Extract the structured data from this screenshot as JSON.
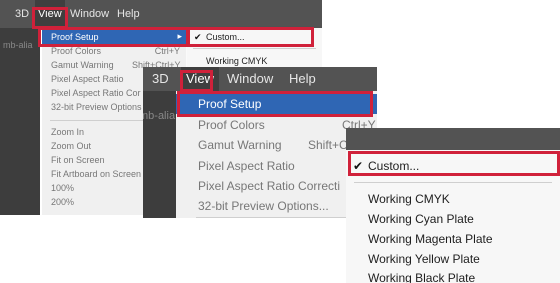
{
  "screen1": {
    "menubar": [
      "3D",
      "View",
      "Window",
      "Help"
    ],
    "tab_ghost": "mb-alia",
    "view_menu": [
      {
        "label": "Proof Setup",
        "shortcut": "",
        "arrow": "▸"
      },
      {
        "label": "Proof Colors",
        "shortcut": "Ctrl+Y"
      },
      {
        "label": "Gamut Warning",
        "shortcut": "Shift+Ctrl+Y"
      },
      {
        "label": "Pixel Aspect Ratio"
      },
      {
        "label": "Pixel Aspect Ratio Cor"
      },
      {
        "label": "32-bit Preview Options"
      },
      {
        "label": "Zoom In"
      },
      {
        "label": "Zoom Out"
      },
      {
        "label": "Fit on Screen"
      },
      {
        "label": "Fit Artboard on Screen"
      },
      {
        "label": "100%"
      },
      {
        "label": "200%"
      }
    ],
    "submenu": {
      "check": "✔",
      "custom": "Custom...",
      "first_item": "Working CMYK"
    }
  },
  "screen2": {
    "menubar": [
      "3D",
      "View",
      "Window",
      "Help"
    ],
    "tab_ghost": "mb-alia",
    "view_menu": [
      {
        "label": "Proof Setup"
      },
      {
        "label": "Proof Colors",
        "shortcut": "Ctrl+Y"
      },
      {
        "label": "Gamut Warning",
        "shortcut": "Shift+C"
      },
      {
        "label": "Pixel Aspect Ratio"
      },
      {
        "label": "Pixel Aspect Ratio Correcti"
      },
      {
        "label": "32-bit Preview Options..."
      }
    ]
  },
  "screen3": {
    "check": "✔",
    "custom": "Custom...",
    "items": [
      "Working CMYK",
      "Working Cyan Plate",
      "Working Magenta Plate",
      "Working Yellow Plate",
      "Working Black Plate"
    ]
  },
  "colors": {
    "accent": "#2f66b4",
    "highlight_border": "#d0213a",
    "menubar": "#535353"
  }
}
